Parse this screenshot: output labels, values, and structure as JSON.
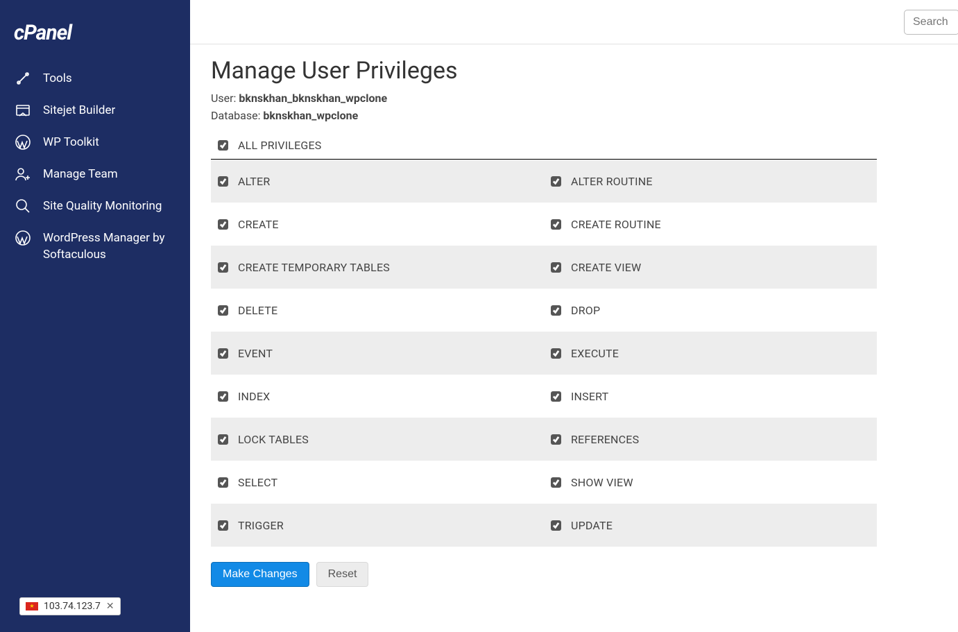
{
  "brand": "cPanel",
  "sidebar": {
    "items": [
      {
        "label": "Tools",
        "icon": "tools"
      },
      {
        "label": "Sitejet Builder",
        "icon": "sitejet"
      },
      {
        "label": "WP Toolkit",
        "icon": "wp"
      },
      {
        "label": "Manage Team",
        "icon": "team"
      },
      {
        "label": "Site Quality Monitoring",
        "icon": "magnify"
      },
      {
        "label": "WordPress Manager by Softaculous",
        "icon": "wp"
      }
    ]
  },
  "ip_bar": {
    "ip": "103.74.123.7"
  },
  "search": {
    "placeholder": "Search"
  },
  "page": {
    "title": "Manage User Privileges",
    "user_label": "User: ",
    "user_value": "bknskhan_bknskhan_wpclone",
    "db_label": "Database: ",
    "db_value": "bknskhan_wpclone"
  },
  "privileges": {
    "all_label": "ALL PRIVILEGES",
    "rows": [
      {
        "left": "ALTER",
        "right": "ALTER ROUTINE"
      },
      {
        "left": "CREATE",
        "right": "CREATE ROUTINE"
      },
      {
        "left": "CREATE TEMPORARY TABLES",
        "right": "CREATE VIEW"
      },
      {
        "left": "DELETE",
        "right": "DROP"
      },
      {
        "left": "EVENT",
        "right": "EXECUTE"
      },
      {
        "left": "INDEX",
        "right": "INSERT"
      },
      {
        "left": "LOCK TABLES",
        "right": "REFERENCES"
      },
      {
        "left": "SELECT",
        "right": "SHOW VIEW"
      },
      {
        "left": "TRIGGER",
        "right": "UPDATE"
      }
    ]
  },
  "actions": {
    "primary": "Make Changes",
    "reset": "Reset"
  }
}
